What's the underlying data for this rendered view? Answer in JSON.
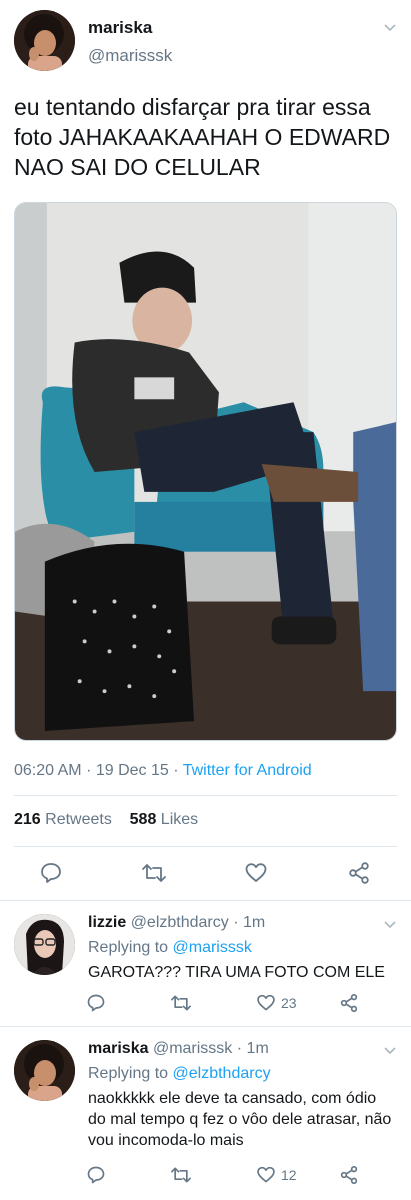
{
  "main_tweet": {
    "name": "mariska",
    "handle": "@marisssk",
    "text": "eu tentando disfarçar pra tirar essa foto JAHAKAAKAAHAH O EDWARD NAO SAI DO CELULAR",
    "time": "06:20 AM",
    "separator": "·",
    "date": "19 Dec 15",
    "client": "Twitter for Android",
    "retweets_count": "216",
    "retweets_label": "Retweets",
    "likes_count": "588",
    "likes_label": "Likes"
  },
  "replies": [
    {
      "name": "lizzie",
      "handle": "@elzbthdarcy",
      "separator": "·",
      "time": "1m",
      "replying_label": "Replying to",
      "replying_to": "@marisssk",
      "text": "GAROTA??? TIRA UMA FOTO COM ELE",
      "like_count": "23"
    },
    {
      "name": "mariska",
      "handle": "@marisssk",
      "separator": "·",
      "time": "1m",
      "replying_label": "Replying to",
      "replying_to": "@elzbthdarcy",
      "text": "naokkkkk ele deve ta cansado, com ódio do mal tempo q fez o vôo dele atrasar, não vou incomoda-lo mais",
      "like_count": "12"
    }
  ],
  "colors": {
    "link": "#1da1f2",
    "secondary": "#657786",
    "primary": "#14171a",
    "divider": "#e1e8ed"
  },
  "icons": [
    "reply-icon",
    "retweet-icon",
    "like-icon",
    "share-icon",
    "chevron-down-icon"
  ]
}
